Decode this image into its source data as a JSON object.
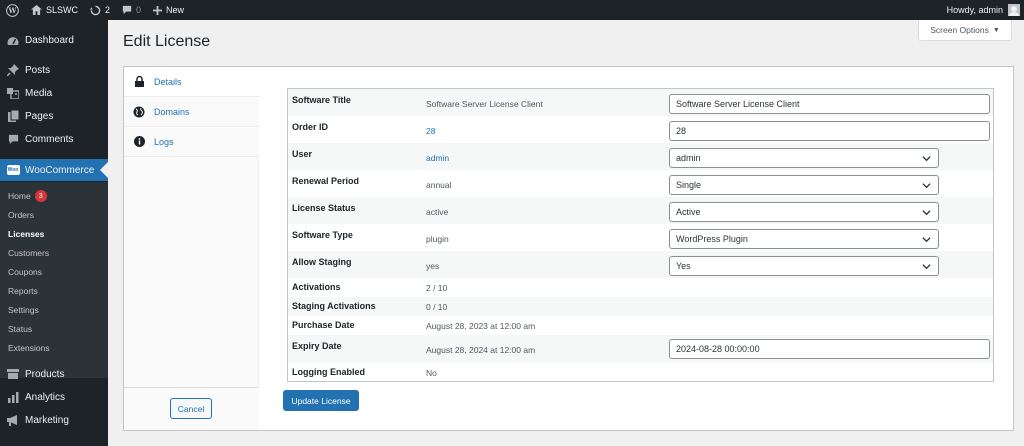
{
  "adminbar": {
    "site_name": "SLSWC",
    "updates_count": "2",
    "comments_count": "0",
    "new_label": "New",
    "greeting": "Howdy, admin"
  },
  "sidebar": {
    "items": [
      {
        "label": "Dashboard",
        "icon": "dashboard-icon"
      },
      {
        "label": "Posts",
        "icon": "pin-icon"
      },
      {
        "label": "Media",
        "icon": "media-icon"
      },
      {
        "label": "Pages",
        "icon": "pages-icon"
      },
      {
        "label": "Comments",
        "icon": "comment-icon"
      },
      {
        "label": "WooCommerce",
        "icon": "woocommerce-icon"
      },
      {
        "label": "Products",
        "icon": "products-icon"
      },
      {
        "label": "Analytics",
        "icon": "analytics-icon"
      },
      {
        "label": "Marketing",
        "icon": "megaphone-icon"
      }
    ],
    "woo_badge": "Woo",
    "submenu": [
      {
        "label": "Home",
        "badge": "3"
      },
      {
        "label": "Orders"
      },
      {
        "label": "Licenses",
        "current": true
      },
      {
        "label": "Customers"
      },
      {
        "label": "Coupons"
      },
      {
        "label": "Reports"
      },
      {
        "label": "Settings"
      },
      {
        "label": "Status"
      },
      {
        "label": "Extensions"
      }
    ]
  },
  "page": {
    "title": "Edit License",
    "screen_options": "Screen Options",
    "screen_options_arrow": "▼"
  },
  "tabs": [
    {
      "label": "Details",
      "icon": "lock-icon",
      "active": true
    },
    {
      "label": "Domains",
      "icon": "globe-icon"
    },
    {
      "label": "Logs",
      "icon": "info-icon"
    }
  ],
  "buttons": {
    "cancel": "Cancel",
    "update": "Update License"
  },
  "fields": [
    {
      "label": "Software Title",
      "value": "Software Server License Client",
      "input": "Software Server License Client",
      "type": "text"
    },
    {
      "label": "Order ID",
      "value": "28",
      "link": true,
      "input": "28",
      "type": "text"
    },
    {
      "label": "User",
      "value": "admin",
      "link": true,
      "input": "admin",
      "type": "select"
    },
    {
      "label": "Renewal Period",
      "value": "annual",
      "input": "Single",
      "type": "select"
    },
    {
      "label": "License Status",
      "value": "active",
      "input": "Active",
      "type": "select"
    },
    {
      "label": "Software Type",
      "value": "plugin",
      "input": "WordPress Plugin",
      "type": "select"
    },
    {
      "label": "Allow Staging",
      "value": "yes",
      "input": "Yes",
      "type": "select"
    },
    {
      "label": "Activations",
      "value": "2 / 10"
    },
    {
      "label": "Staging Activations",
      "value": "0 / 10"
    },
    {
      "label": "Purchase Date",
      "value": "August 28, 2023 at 12:00 am"
    },
    {
      "label": "Expiry Date",
      "value": "August 28, 2024 at 12:00 am",
      "input": "2024-08-28 00:00:00",
      "type": "text"
    },
    {
      "label": "Logging Enabled",
      "value": "No"
    }
  ],
  "colors": {
    "accent": "#2271b1",
    "sidebar_bg": "#1d2327",
    "submenu_bg": "#2c3338",
    "badge": "#d63638"
  }
}
